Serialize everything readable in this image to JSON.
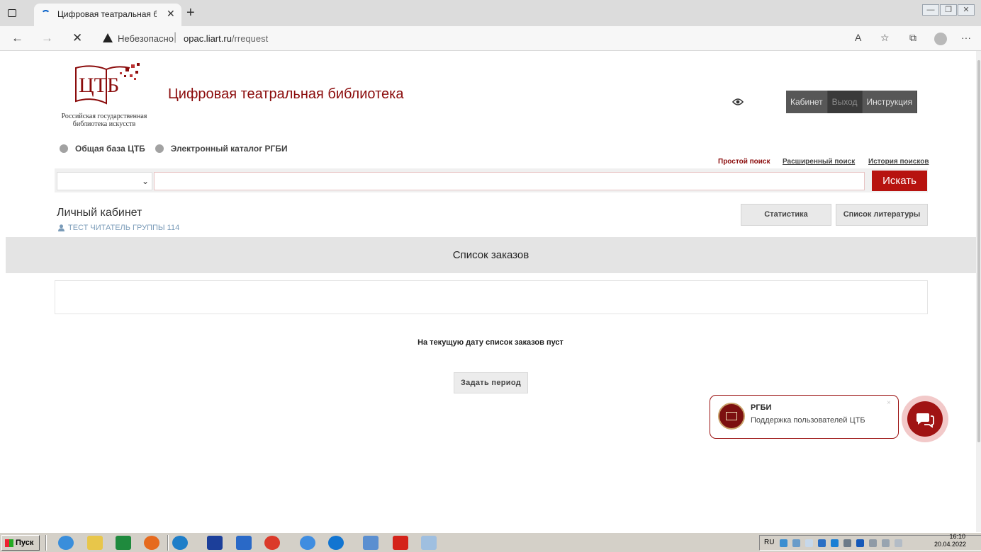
{
  "browser": {
    "tab_title": "Цифровая театральная библио",
    "tab_close": "✕",
    "new_tab": "+",
    "insecure_label": "Небезопасно",
    "url_host": "opac.liart.ru",
    "url_path": "/rrequest",
    "window_controls": [
      "—",
      "❐",
      "✕"
    ]
  },
  "site": {
    "logo_text": "ЦТБ",
    "logo_caption": "Российская государственная библиотека искусств",
    "title": "Цифровая театральная библиотека",
    "top_buttons": [
      "Кабинет",
      "Выход",
      "Инструкция"
    ]
  },
  "catalog_options": [
    "Общая база ЦТБ",
    "Электронный каталог РГБИ"
  ],
  "search": {
    "links": [
      "Простой поиск",
      "Расширенный поиск",
      "История поисков"
    ],
    "select_value": "",
    "input_value": "",
    "button": "Искать"
  },
  "cabinet": {
    "title": "Личный кабинет",
    "user": "ТЕСТ ЧИТАТЕЛЬ ГРУППЫ 114",
    "tabs": [
      "Статистика",
      "Список литературы"
    ]
  },
  "orders": {
    "title": "Список заказов",
    "empty_message": "На текущую дату список заказов пуст",
    "period_button": "Задать период"
  },
  "chat": {
    "name": "РГБИ",
    "message": "Поддержка пользователей ЦТБ",
    "close": "×"
  },
  "taskbar": {
    "start": "Пуск",
    "lang": "RU",
    "time": "16:10",
    "date": "20.04.2022"
  },
  "colors": {
    "brand": "#8b0c0c",
    "search_button": "#b7130f",
    "nav_dark": "#575757"
  }
}
